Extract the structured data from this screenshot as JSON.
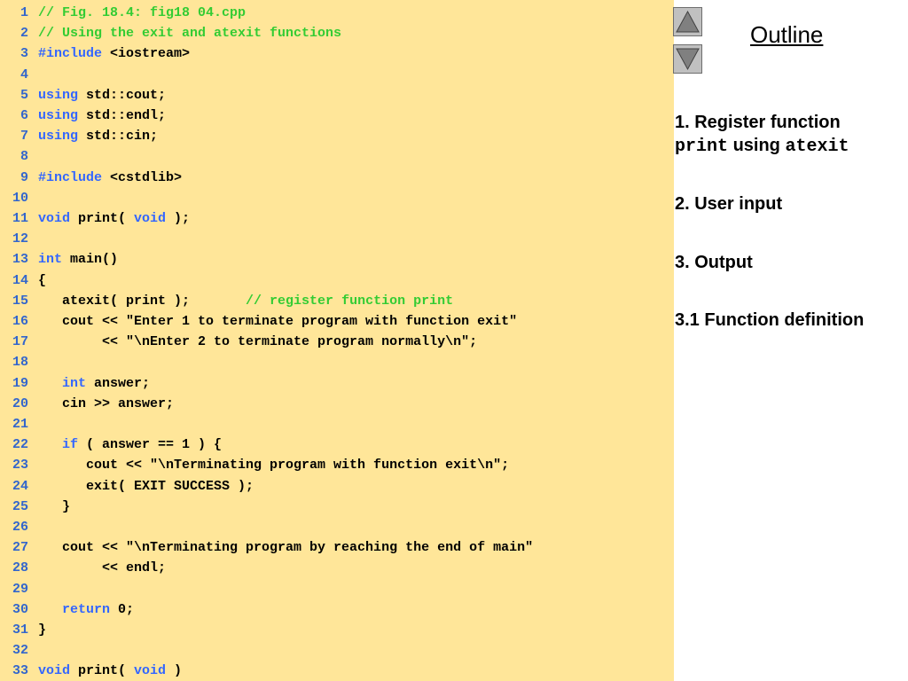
{
  "code": {
    "lines": [
      {
        "num": "1",
        "tokens": [
          {
            "t": "// Fig. 18.4: fig18 04.cpp",
            "k": "cm"
          }
        ]
      },
      {
        "num": "2",
        "tokens": [
          {
            "t": "// Using the exit and atexit functions",
            "k": "cm"
          }
        ]
      },
      {
        "num": "3",
        "tokens": [
          {
            "t": "#include",
            "k": "kw"
          },
          {
            "t": " <iostream>",
            "k": "tx"
          }
        ]
      },
      {
        "num": "4",
        "tokens": []
      },
      {
        "num": "5",
        "tokens": [
          {
            "t": "using",
            "k": "kw"
          },
          {
            "t": " std::cout;",
            "k": "tx"
          }
        ]
      },
      {
        "num": "6",
        "tokens": [
          {
            "t": "using",
            "k": "kw"
          },
          {
            "t": " std::endl;",
            "k": "tx"
          }
        ]
      },
      {
        "num": "7",
        "tokens": [
          {
            "t": "using",
            "k": "kw"
          },
          {
            "t": " std::cin;",
            "k": "tx"
          }
        ]
      },
      {
        "num": "8",
        "tokens": []
      },
      {
        "num": "9",
        "tokens": [
          {
            "t": "#include",
            "k": "kw"
          },
          {
            "t": " <cstdlib>",
            "k": "tx"
          }
        ]
      },
      {
        "num": "10",
        "tokens": []
      },
      {
        "num": "11",
        "tokens": [
          {
            "t": "void",
            "k": "kw"
          },
          {
            "t": " print( ",
            "k": "tx"
          },
          {
            "t": "void",
            "k": "kw"
          },
          {
            "t": " );",
            "k": "tx"
          }
        ]
      },
      {
        "num": "12",
        "tokens": []
      },
      {
        "num": "13",
        "tokens": [
          {
            "t": "int",
            "k": "kw"
          },
          {
            "t": " main()",
            "k": "tx"
          }
        ]
      },
      {
        "num": "14",
        "tokens": [
          {
            "t": "{",
            "k": "tx"
          }
        ]
      },
      {
        "num": "15",
        "tokens": [
          {
            "t": "   atexit( print );       ",
            "k": "tx"
          },
          {
            "t": "// register function print",
            "k": "cm"
          }
        ]
      },
      {
        "num": "16",
        "tokens": [
          {
            "t": "   cout << \"Enter 1 to terminate program with function exit\"",
            "k": "tx"
          }
        ]
      },
      {
        "num": "17",
        "tokens": [
          {
            "t": "        << \"\\nEnter 2 to terminate program normally\\n\";",
            "k": "tx"
          }
        ]
      },
      {
        "num": "18",
        "tokens": []
      },
      {
        "num": "19",
        "tokens": [
          {
            "t": "   ",
            "k": "tx"
          },
          {
            "t": "int",
            "k": "kw"
          },
          {
            "t": " answer;",
            "k": "tx"
          }
        ]
      },
      {
        "num": "20",
        "tokens": [
          {
            "t": "   cin >> answer;",
            "k": "tx"
          }
        ]
      },
      {
        "num": "21",
        "tokens": []
      },
      {
        "num": "22",
        "tokens": [
          {
            "t": "   ",
            "k": "tx"
          },
          {
            "t": "if",
            "k": "kw"
          },
          {
            "t": " ( answer == 1 ) {",
            "k": "tx"
          }
        ]
      },
      {
        "num": "23",
        "tokens": [
          {
            "t": "      cout << \"\\nTerminating program with function exit\\n\";",
            "k": "tx"
          }
        ]
      },
      {
        "num": "24",
        "tokens": [
          {
            "t": "      exit( EXIT SUCCESS );",
            "k": "tx"
          }
        ]
      },
      {
        "num": "25",
        "tokens": [
          {
            "t": "   }",
            "k": "tx"
          }
        ]
      },
      {
        "num": "26",
        "tokens": []
      },
      {
        "num": "27",
        "tokens": [
          {
            "t": "   cout << \"\\nTerminating program by reaching the end of main\"",
            "k": "tx"
          }
        ]
      },
      {
        "num": "28",
        "tokens": [
          {
            "t": "        << endl;",
            "k": "tx"
          }
        ]
      },
      {
        "num": "29",
        "tokens": []
      },
      {
        "num": "30",
        "tokens": [
          {
            "t": "   ",
            "k": "tx"
          },
          {
            "t": "return",
            "k": "kw"
          },
          {
            "t": " 0;",
            "k": "tx"
          }
        ]
      },
      {
        "num": "31",
        "tokens": [
          {
            "t": "}",
            "k": "tx"
          }
        ]
      },
      {
        "num": "32",
        "tokens": []
      },
      {
        "num": "33",
        "tokens": [
          {
            "t": "void",
            "k": "kw"
          },
          {
            "t": " print( ",
            "k": "tx"
          },
          {
            "t": "void",
            "k": "kw"
          },
          {
            "t": " )",
            "k": "tx"
          }
        ]
      }
    ]
  },
  "nav": {
    "prev_icon": "triangle-up-icon",
    "next_icon": "triangle-down-icon"
  },
  "outline": {
    "title": "Outline",
    "item1_prefix": "1. Register function",
    "item1_code1": "print",
    "item1_mid": " using ",
    "item1_code2": "atexit",
    "item2": "2. User input",
    "item3": "3. Output",
    "item4": "3.1 Function definition"
  },
  "colors": {
    "code_background": "#ffe699",
    "keyword": "#3366ff",
    "comment": "#33cc33",
    "line_number": "#3366cc"
  }
}
